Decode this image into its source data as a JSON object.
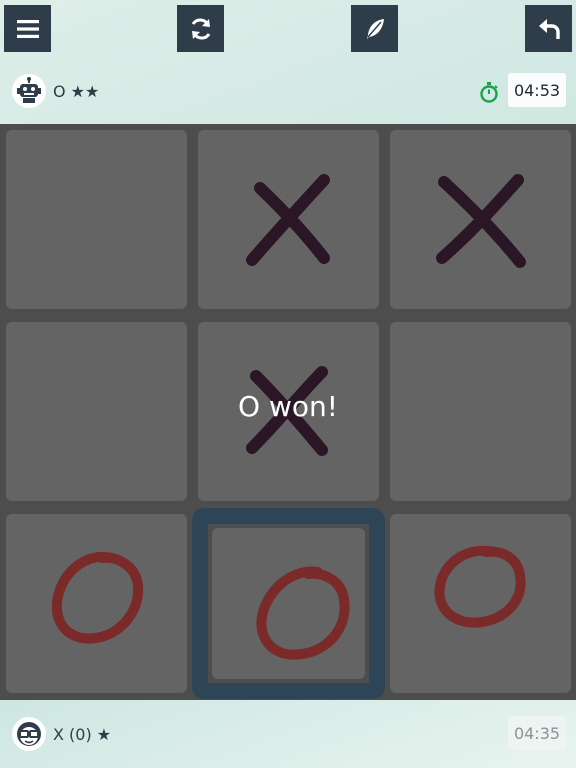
{
  "toolbar": {
    "menu_icon": "hamburger-menu-icon",
    "restart_icon": "refresh-icon",
    "hint_icon": "feather-icon",
    "undo_icon": "undo-arrow-icon"
  },
  "top_player": {
    "avatar_icon": "robot-icon",
    "name": "O ★★",
    "timer_icon": "stopwatch-icon",
    "timer": "04:53"
  },
  "bottom_player": {
    "avatar_icon": "nerd-face-icon",
    "name": "X (0) ★",
    "timer": "04:35"
  },
  "board": {
    "cells": [
      "",
      "X",
      "X",
      "",
      "X",
      "",
      "O",
      "O",
      "O"
    ],
    "highlighted_cell": 7,
    "result": "O won!"
  },
  "colors": {
    "x_mark": "#2a1624",
    "o_mark": "#7a2a28",
    "cell": "#646464",
    "board": "#4d4d4d",
    "highlight": "#2e4558",
    "button": "#2f3d4a"
  }
}
